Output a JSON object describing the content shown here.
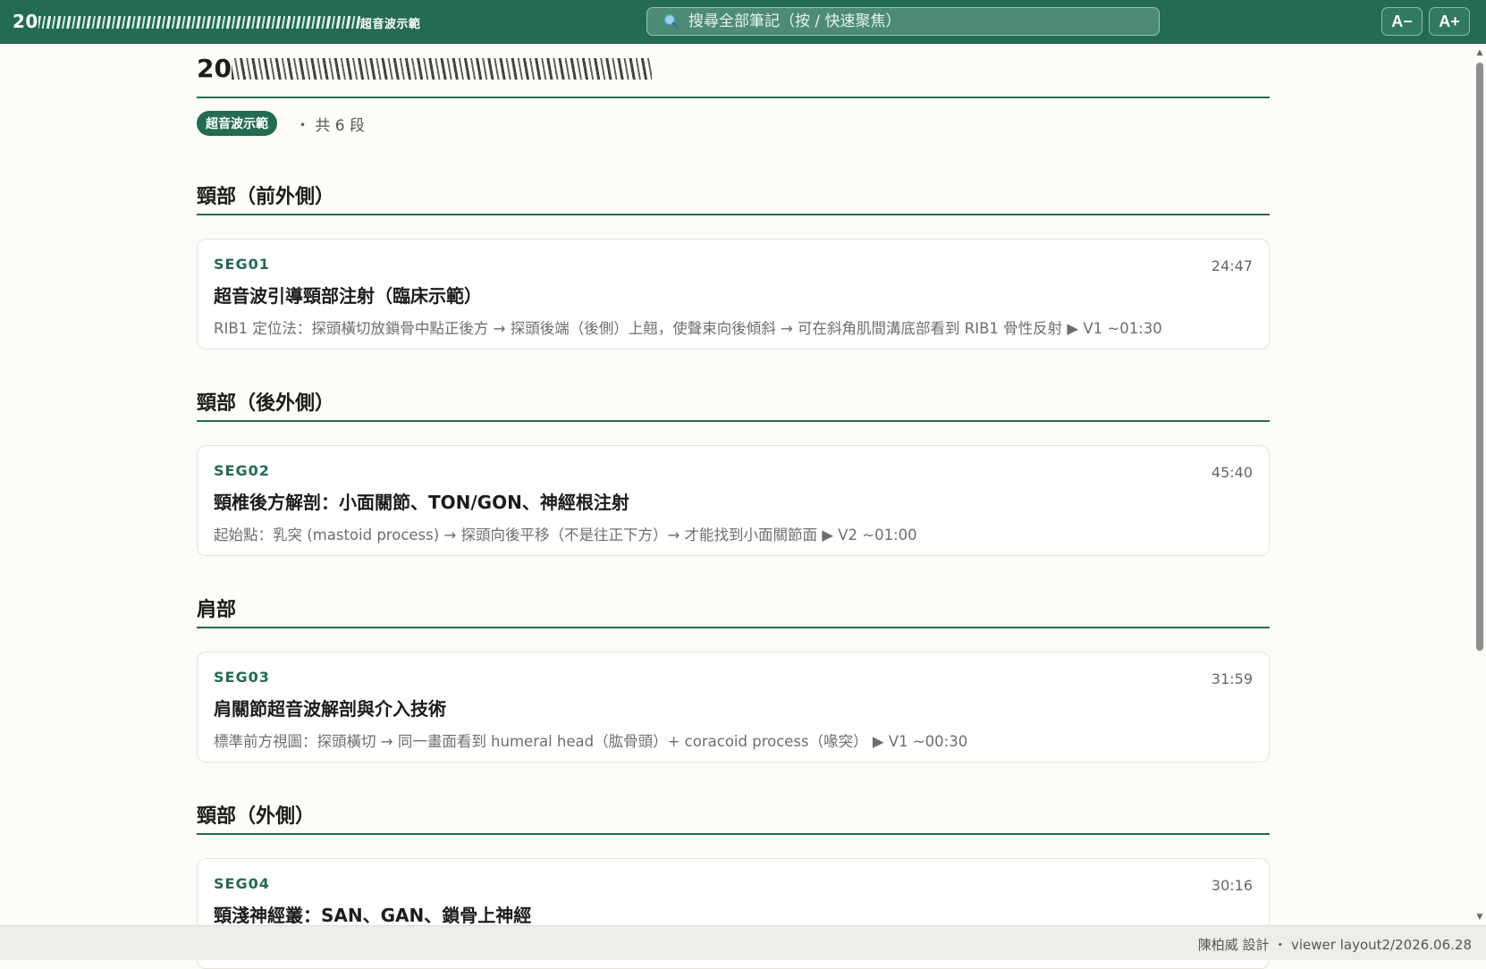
{
  "header": {
    "title_prefix": "20",
    "title_suffix": "超音波示範",
    "search_placeholder": "搜尋全部筆記（按 / 快速聚焦）",
    "font_decrease": "A−",
    "font_increase": "A+"
  },
  "page": {
    "title_prefix": "20",
    "tag": "超音波示範",
    "count_label": "・ 共 6 段"
  },
  "sections": [
    {
      "title": "頸部（前外側）",
      "card": {
        "id": "SEG01",
        "duration": "24:47",
        "title": "超音波引導頸部注射（臨床示範）",
        "desc": "RIB1 定位法：探頭橫切放鎖骨中點正後方 → 探頭後端（後側）上翹，使聲束向後傾斜 → 可在斜角肌間溝底部看到 RIB1 骨性反射 ▶ V1 ~01:30"
      }
    },
    {
      "title": "頸部（後外側）",
      "card": {
        "id": "SEG02",
        "duration": "45:40",
        "title": "頸椎後方解剖：小面關節、TON/GON、神經根注射",
        "desc": "起始點：乳突 (mastoid process) → 探頭向後平移（不是往正下方）→ 才能找到小面關節面 ▶ V2 ~01:00"
      }
    },
    {
      "title": "肩部",
      "card": {
        "id": "SEG03",
        "duration": "31:59",
        "title": "肩關節超音波解剖與介入技術",
        "desc": "標準前方視圖：探頭橫切 → 同一畫面看到 humeral head（肱骨頭）+ coracoid process（喙突） ▶ V1 ~00:30"
      }
    },
    {
      "title": "頸部（外側）",
      "card": {
        "id": "SEG04",
        "duration": "30:16",
        "title": "頸淺神經叢：SAN、GAN、鎖骨上神經",
        "desc": ""
      }
    }
  ],
  "footer": {
    "text": "陳柏威 設計 ・ viewer layout2/2026.06.28"
  },
  "colors": {
    "primary": "#236b52",
    "background": "#fdfcf8"
  }
}
